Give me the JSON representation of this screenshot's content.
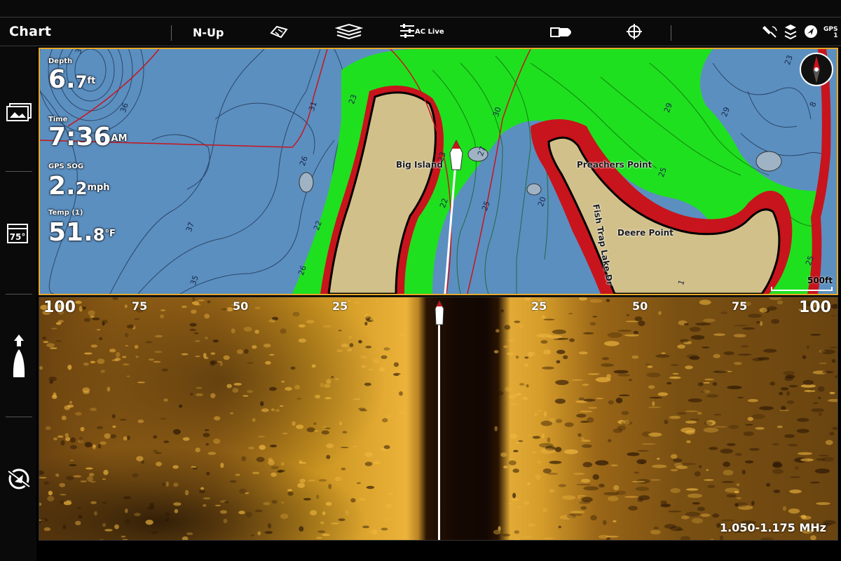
{
  "topbar": {
    "title": "Chart",
    "orientation": "N-Up",
    "ac_live": "AC Live",
    "gps": "GPS",
    "gps_sub": "1"
  },
  "sidebar": {
    "temp_icon_value": "75°"
  },
  "chart": {
    "depth": {
      "label": "Depth",
      "value": "6.",
      "decimal": "7",
      "unit": "ft"
    },
    "time": {
      "label": "Time",
      "value": "7:36",
      "suffix": "AM"
    },
    "sog": {
      "label": "GPS SOG",
      "value": "2.",
      "decimal": "2",
      "unit": "mph"
    },
    "temp": {
      "label": "Temp (1)",
      "value": "51.",
      "decimal": "8",
      "unit": "°F"
    },
    "places": {
      "big_island": "Big Island",
      "preachers_point": "Preachers Point",
      "deere_point": "Deere Point",
      "fish_trap": "Fish Trap Lake Dr"
    },
    "scale": "500ft",
    "contours": [
      "32",
      "36",
      "31",
      "23",
      "26",
      "22",
      "26",
      "37",
      "35",
      "23",
      "27",
      "30",
      "22",
      "25",
      "20",
      "29",
      "29",
      "25",
      "8",
      "25",
      "1",
      "23"
    ]
  },
  "sonar": {
    "ranges_left": [
      "100",
      "75",
      "50",
      "25"
    ],
    "ranges_right": [
      "25",
      "50",
      "75",
      "100"
    ],
    "frequency": "1.050-1.175 MHz"
  },
  "colors": {
    "accent_border": "#e7a72a",
    "water": "#5b8fc0",
    "shallow": "#1fe01f",
    "land": "#d2c08a",
    "drop": "#c8141c"
  }
}
